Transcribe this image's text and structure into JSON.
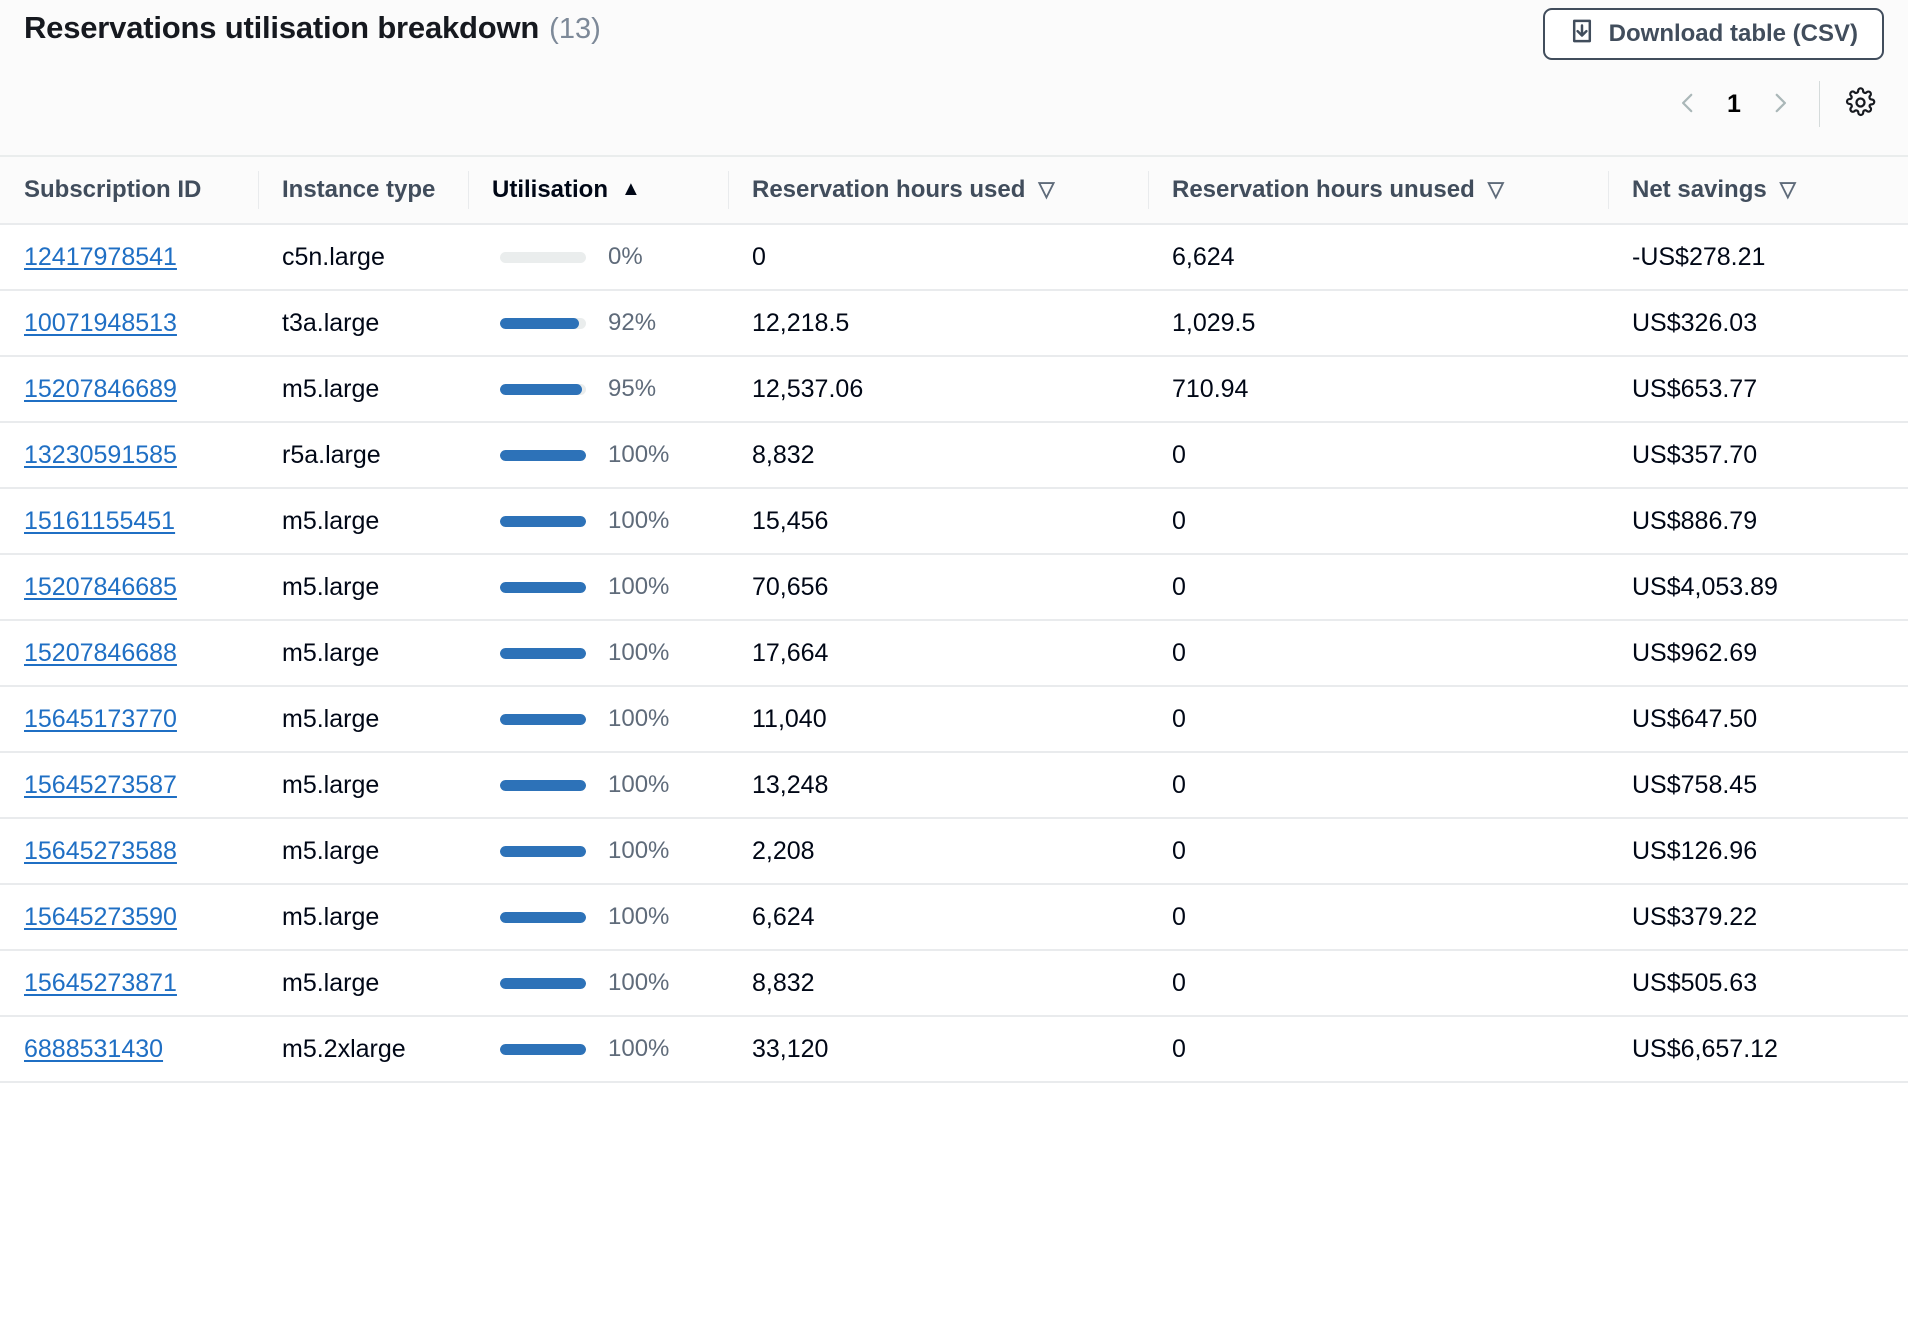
{
  "header": {
    "title": "Reservations utilisation breakdown",
    "count": "(13)",
    "download_label": "Download table (CSV)",
    "download_icon": "download-icon",
    "pagination": {
      "prev_icon": "chevron-left-icon",
      "next_icon": "chevron-right-icon",
      "current_page": "1"
    },
    "settings_icon": "gear-icon"
  },
  "table": {
    "columns": [
      {
        "label": "Subscription ID",
        "sort": "none"
      },
      {
        "label": "Instance type",
        "sort": "none"
      },
      {
        "label": "Utilisation",
        "sort": "asc",
        "sort_glyph": "▲"
      },
      {
        "label": "Reservation hours used",
        "sort": "none",
        "sort_glyph": "▽"
      },
      {
        "label": "Reservation hours unused",
        "sort": "none",
        "sort_glyph": "▽"
      },
      {
        "label": "Net savings",
        "sort": "none",
        "sort_glyph": "▽"
      }
    ],
    "rows": [
      {
        "subscription_id": "12417978541",
        "instance_type": "c5n.large",
        "utilisation_pct": 0,
        "utilisation_label": "0%",
        "hours_used": "0",
        "hours_unused": "6,624",
        "net_savings": "-US$278.21"
      },
      {
        "subscription_id": "10071948513",
        "instance_type": "t3a.large",
        "utilisation_pct": 92,
        "utilisation_label": "92%",
        "hours_used": "12,218.5",
        "hours_unused": "1,029.5",
        "net_savings": "US$326.03"
      },
      {
        "subscription_id": "15207846689",
        "instance_type": "m5.large",
        "utilisation_pct": 95,
        "utilisation_label": "95%",
        "hours_used": "12,537.06",
        "hours_unused": "710.94",
        "net_savings": "US$653.77"
      },
      {
        "subscription_id": "13230591585",
        "instance_type": "r5a.large",
        "utilisation_pct": 100,
        "utilisation_label": "100%",
        "hours_used": "8,832",
        "hours_unused": "0",
        "net_savings": "US$357.70"
      },
      {
        "subscription_id": "15161155451",
        "instance_type": "m5.large",
        "utilisation_pct": 100,
        "utilisation_label": "100%",
        "hours_used": "15,456",
        "hours_unused": "0",
        "net_savings": "US$886.79"
      },
      {
        "subscription_id": "15207846685",
        "instance_type": "m5.large",
        "utilisation_pct": 100,
        "utilisation_label": "100%",
        "hours_used": "70,656",
        "hours_unused": "0",
        "net_savings": "US$4,053.89"
      },
      {
        "subscription_id": "15207846688",
        "instance_type": "m5.large",
        "utilisation_pct": 100,
        "utilisation_label": "100%",
        "hours_used": "17,664",
        "hours_unused": "0",
        "net_savings": "US$962.69"
      },
      {
        "subscription_id": "15645173770",
        "instance_type": "m5.large",
        "utilisation_pct": 100,
        "utilisation_label": "100%",
        "hours_used": "11,040",
        "hours_unused": "0",
        "net_savings": "US$647.50"
      },
      {
        "subscription_id": "15645273587",
        "instance_type": "m5.large",
        "utilisation_pct": 100,
        "utilisation_label": "100%",
        "hours_used": "13,248",
        "hours_unused": "0",
        "net_savings": "US$758.45"
      },
      {
        "subscription_id": "15645273588",
        "instance_type": "m5.large",
        "utilisation_pct": 100,
        "utilisation_label": "100%",
        "hours_used": "2,208",
        "hours_unused": "0",
        "net_savings": "US$126.96"
      },
      {
        "subscription_id": "15645273590",
        "instance_type": "m5.large",
        "utilisation_pct": 100,
        "utilisation_label": "100%",
        "hours_used": "6,624",
        "hours_unused": "0",
        "net_savings": "US$379.22"
      },
      {
        "subscription_id": "15645273871",
        "instance_type": "m5.large",
        "utilisation_pct": 100,
        "utilisation_label": "100%",
        "hours_used": "8,832",
        "hours_unused": "0",
        "net_savings": "US$505.63"
      },
      {
        "subscription_id": "6888531430",
        "instance_type": "m5.2xlarge",
        "utilisation_pct": 100,
        "utilisation_label": "100%",
        "hours_used": "33,120",
        "hours_unused": "0",
        "net_savings": "US$6,657.12"
      }
    ]
  },
  "colors": {
    "bar_fill": "#2d72b8",
    "bar_track": "#eaeded",
    "link": "#1f6fc4",
    "header_text": "#414d5c",
    "panel_bg": "#fbfbfb"
  }
}
